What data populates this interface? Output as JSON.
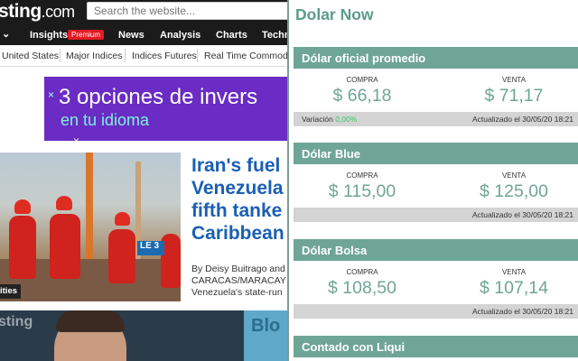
{
  "site": {
    "logo": "sting",
    "logo_suffix": ".com",
    "search_placeholder": "Search the website...",
    "nav": {
      "chevron": "⌄",
      "items": [
        "Insights",
        "News",
        "Analysis",
        "Charts",
        "Techn"
      ],
      "premium_badge": "Premium"
    },
    "subnav": [
      "United States",
      "Major Indices",
      "Indices Futures",
      "Real Time Commoditi"
    ],
    "ad": {
      "line1": "3 opciones de invers",
      "line2": "en tu idioma",
      "close_glyph": "×"
    },
    "photo": {
      "sign_text": "LE 3",
      "category_tag": "ities"
    },
    "headline": {
      "line1": "Iran's fuel",
      "line2": "Venezuela",
      "line3": "fifth tanke",
      "line4": "Caribbean"
    },
    "byline": {
      "line1": "By Deisy Buitrago and",
      "line2": "CARACAS/MARACAY",
      "line3": "Venezuela's state-run"
    },
    "strip": {
      "logo": "sting",
      "blue_text": "Blo"
    }
  },
  "popup": {
    "title": "Dolar Now",
    "cards": [
      {
        "title": "Dólar oficial promedio",
        "buy_label": "COMPRA",
        "buy_value": "$ 66,18",
        "sell_label": "VENTA",
        "sell_value": "$ 71,17",
        "variation_label": "Variación",
        "variation_value": "0,00%",
        "updated": "Actualizado el 30/05/20 18:21"
      },
      {
        "title": "Dólar Blue",
        "buy_label": "COMPRA",
        "buy_value": "$ 115,00",
        "sell_label": "VENTA",
        "sell_value": "$ 125,00",
        "updated": "Actualizado el 30/05/20 18:21"
      },
      {
        "title": "Dólar Bolsa",
        "buy_label": "COMPRA",
        "buy_value": "$ 108,50",
        "sell_label": "VENTA",
        "sell_value": "$ 107,14",
        "updated": "Actualizado el 30/05/20 18:21"
      },
      {
        "title": "Contado con Liqui"
      }
    ]
  },
  "colors": {
    "accent": "#6fa596",
    "title": "#5a9c8a",
    "variation_positive": "#3ec26a",
    "footer_gray": "#d4d4d4",
    "site_dark": "#1b1b1b",
    "headline_blue": "#1a5fb4",
    "ad_purple": "#6a2cc4"
  }
}
